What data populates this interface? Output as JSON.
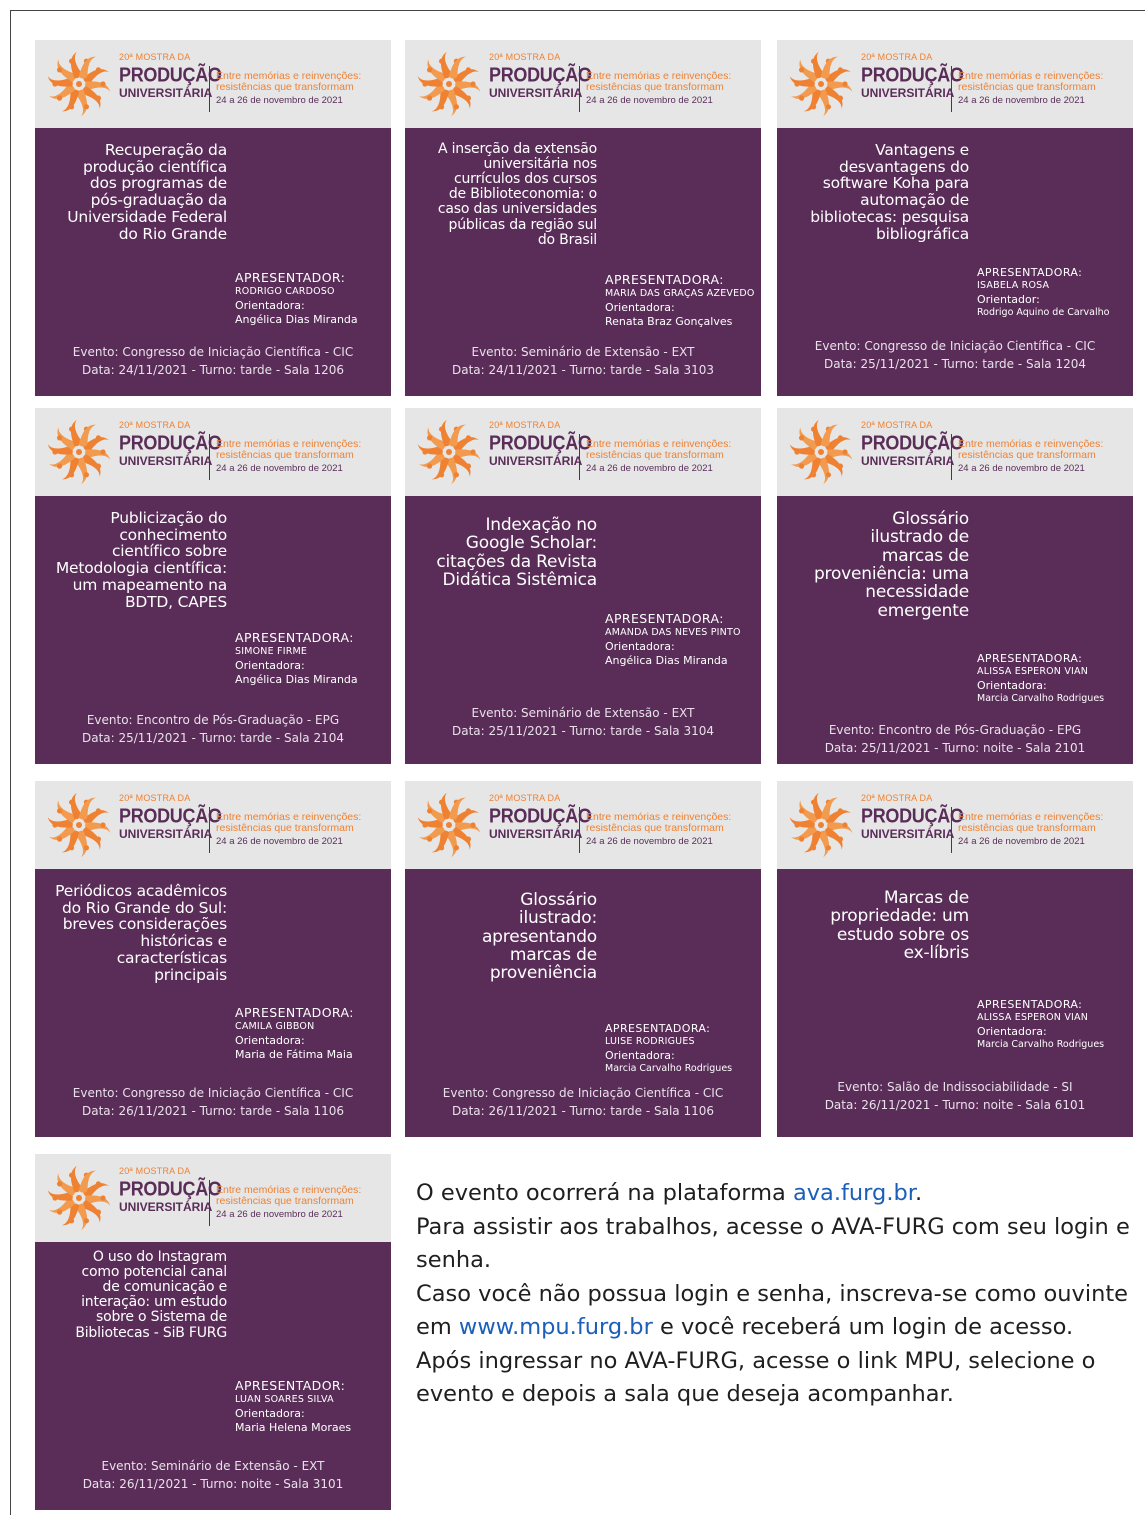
{
  "brand": {
    "edition": "20ª MOSTRA DA",
    "name1": "PRODUÇÃO",
    "name2": "UNIVERSITÁRIA",
    "tag1": "Entre memórias e reinvenções:",
    "tag2": "resistências que transformam",
    "dates": "24 a 26 de novembro de 2021"
  },
  "cards": [
    {
      "title": "Recuperação da\nprodução científica\ndos programas de\npós-graduação da\nUniversidade Federal\ndo Rio Grande",
      "role": "APRESENTADOR:",
      "presenter": "RODRIGO CARDOSO",
      "advisor_label": "Orientadora:",
      "advisor": "Angélica Dias Miranda",
      "event": "Evento: Congresso de Iniciação Científica - CIC",
      "datetime": "Data: 24/11/2021 - Turno: tarde - Sala 1206"
    },
    {
      "title": "A inserção da extensão\nuniversitária nos\ncurrículos dos cursos\nde Biblioteconomia: o\ncaso das universidades\npúblicas da região sul\ndo Brasil",
      "role": "APRESENTADORA:",
      "presenter": "MARIA DAS GRAÇAS AZEVEDO",
      "advisor_label": "Orientadora:",
      "advisor": "Renata Braz Gonçalves",
      "event": "Evento: Seminário de Extensão - EXT",
      "datetime": "Data: 24/11/2021 - Turno: tarde - Sala 3103"
    },
    {
      "title": "Vantagens e\ndesvantagens do\nsoftware Koha para\nautomação de\nbibliotecas: pesquisa\nbibliográfica",
      "role": "APRESENTADORA:",
      "presenter": "ISABELA ROSA",
      "advisor_label": "Orientador:",
      "advisor": "Rodrigo Aquino de Carvalho",
      "event": "Evento: Congresso de Iniciação Científica - CIC",
      "datetime": "Data: 25/11/2021 - Turno: tarde - Sala 1204"
    },
    {
      "title": "Publicização do\nconhecimento\ncientífico sobre\nMetodologia científica:\num mapeamento na\nBDTD, CAPES",
      "role": "APRESENTADORA:",
      "presenter": "SIMONE FIRME",
      "advisor_label": "Orientadora:",
      "advisor": "Angélica Dias Miranda",
      "event": "Evento: Encontro de Pós-Graduação - EPG",
      "datetime": "Data: 25/11/2021 - Turno: tarde - Sala 2104"
    },
    {
      "title": "Indexação no\nGoogle Scholar:\ncitações da Revista\nDidática Sistêmica",
      "role": "APRESENTADORA:",
      "presenter": "AMANDA DAS NEVES PINTO",
      "advisor_label": "Orientadora:",
      "advisor": "Angélica Dias Miranda",
      "event": "Evento: Seminário de Extensão - EXT",
      "datetime": "Data: 25/11/2021 - Turno: tarde - Sala 3104"
    },
    {
      "title": "Glossário\nilustrado de\nmarcas de\nproveniência: uma\nnecessidade\nemergente",
      "role": "APRESENTADORA:",
      "presenter": "ALISSA ESPERON VIAN",
      "advisor_label": "Orientadora:",
      "advisor": "Marcia Carvalho Rodrigues",
      "event": "Evento: Encontro de Pós-Graduação - EPG",
      "datetime": "Data: 25/11/2021 - Turno: noite - Sala 2101"
    },
    {
      "title": "Periódicos acadêmicos\ndo Rio Grande do Sul:\nbreves considerações\nhistóricas e\ncaracterísticas\nprincipais",
      "role": "APRESENTADORA:",
      "presenter": "CAMILA GIBBON",
      "advisor_label": "Orientadora:",
      "advisor": "Maria de Fátima Maia",
      "event": "Evento: Congresso de Iniciação Científica - CIC",
      "datetime": "Data: 26/11/2021 - Turno: tarde - Sala 1106"
    },
    {
      "title": "Glossário\nilustrado:\napresentando\nmarcas de\nproveniência",
      "role": "APRESENTADORA:",
      "presenter": "LUISE RODRIGUES",
      "advisor_label": "Orientadora:",
      "advisor": "Marcia Carvalho Rodrigues",
      "event": "Evento: Congresso de Iniciação Científica - CIC",
      "datetime": "Data: 26/11/2021 - Turno: tarde - Sala 1106"
    },
    {
      "title": "Marcas de\npropriedade: um\nestudo sobre os\nex-líbris",
      "role": "APRESENTADORA:",
      "presenter": "ALISSA ESPERON VIAN",
      "advisor_label": "Orientadora:",
      "advisor": "Marcia Carvalho Rodrigues",
      "event": "Evento: Salão de Indissociabilidade - SI",
      "datetime": "Data: 26/11/2021 - Turno: noite - Sala 6101"
    },
    {
      "title": "O uso do Instagram\ncomo potencial canal\nde comunicação e\ninteração: um estudo\nsobre o Sistema de\nBibliotecas - SiB FURG",
      "role": "APRESENTADOR:",
      "presenter": "LUAN SOARES SILVA",
      "advisor_label": "Orientadora:",
      "advisor": "Maria Helena Moraes",
      "event": "Evento: Seminário de Extensão - EXT",
      "datetime": "Data: 26/11/2021 - Turno: noite - Sala 3101"
    }
  ],
  "info": {
    "p1_a": "O evento ocorrerá na plataforma ",
    "p1_link": "ava.furg.br",
    "p1_b": ".",
    "p2": "Para assistir aos trabalhos, acesse o AVA-FURG com seu login e senha.",
    "p3_a": "Caso você não possua login e senha, inscreva-se como ouvinte em ",
    "p3_link": "www.mpu.furg.br",
    "p3_b": " e você receberá um login de acesso.",
    "p4": "Após ingressar no AVA-FURG, acesse o link MPU, selecione o evento e depois a sala que deseja acompanhar."
  },
  "colors": {
    "purple": "#5a2d59",
    "orange": "#ef8132",
    "banner": "#e6e6e6",
    "link": "#1b5fb8"
  }
}
